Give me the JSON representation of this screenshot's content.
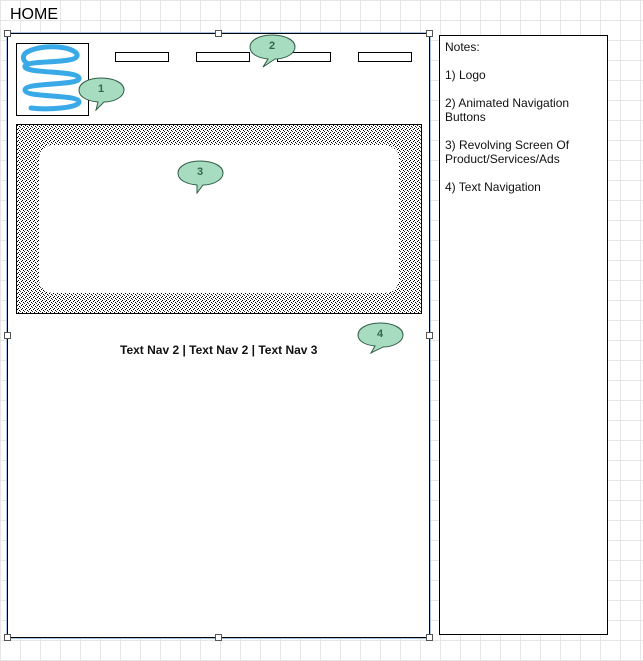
{
  "page": {
    "title": "HOME"
  },
  "wireframe": {
    "text_nav": "Text Nav 2 | Text Nav 2 | Text Nav 3",
    "callouts": [
      "1",
      "2",
      "3",
      "4"
    ],
    "colors": {
      "logo_spiral": "#3aa9e8",
      "callout_fill": "#a8dcc0",
      "callout_text": "#2e6b4a",
      "selection_outline": "#a9c6e8"
    }
  },
  "notes": {
    "title": "Notes:",
    "items": [
      "1) Logo",
      "2) Animated Navigation Buttons",
      "3) Revolving Screen Of Product/Services/Ads",
      "4) Text Navigation"
    ]
  }
}
